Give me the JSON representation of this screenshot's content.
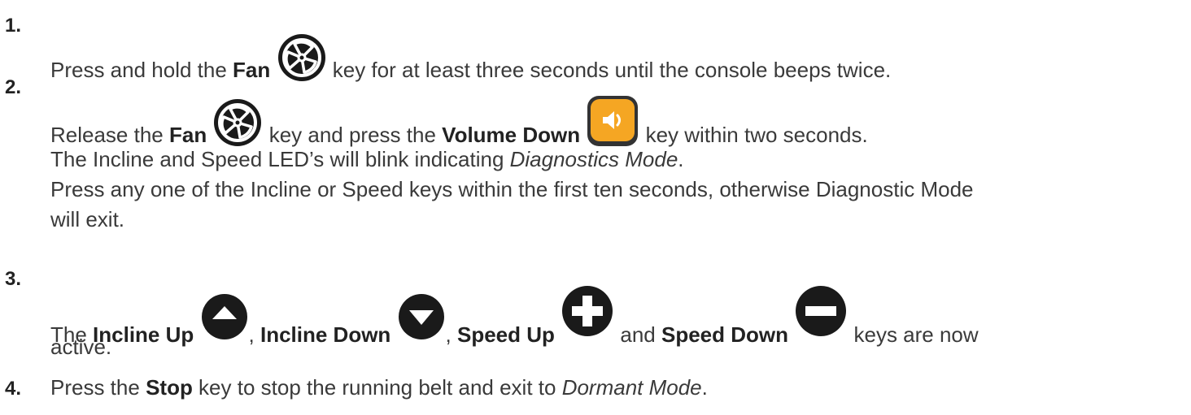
{
  "steps": [
    {
      "number": "1.",
      "text": {
        "a": "Press and hold the ",
        "fan": "Fan",
        "b": " key for at least three seconds until the console beeps twice."
      }
    },
    {
      "number": "2.",
      "text": {
        "a": "Release the ",
        "fan": "Fan",
        "b": " key and press the ",
        "vol": "Volume Down",
        "c": " key within two seconds."
      },
      "line2": {
        "a": "The Incline and Speed LED’s will blink indicating ",
        "mode": "Diagnostics Mode",
        "b": "."
      },
      "line3": "Press any one of the Incline or Speed keys within the first ten seconds, otherwise Diagnostic Mode",
      "line4": "will exit."
    },
    {
      "number": "3.",
      "text": {
        "a": "The ",
        "incline_up": "Incline Up",
        "b": ", ",
        "incline_down": "Incline Down",
        "c": ", ",
        "speed_up": "Speed Up",
        "d": " and ",
        "speed_down": "Speed Down",
        "e": " keys are now"
      },
      "line2": "active."
    },
    {
      "number": "4.",
      "text": {
        "a": "Press the ",
        "stop": "Stop",
        "b": " key to stop the running belt and exit to ",
        "mode": "Dormant Mode",
        "c": "."
      }
    }
  ],
  "icons": {
    "fan": "fan-icon",
    "volume_down": "volume-down-icon",
    "incline_up": "incline-up-icon",
    "incline_down": "incline-down-icon",
    "speed_up": "speed-up-icon",
    "speed_down": "speed-down-icon"
  },
  "colors": {
    "text": "#3a3a3a",
    "volume_key": "#f5a623",
    "key_dark": "#1a1a1a"
  }
}
